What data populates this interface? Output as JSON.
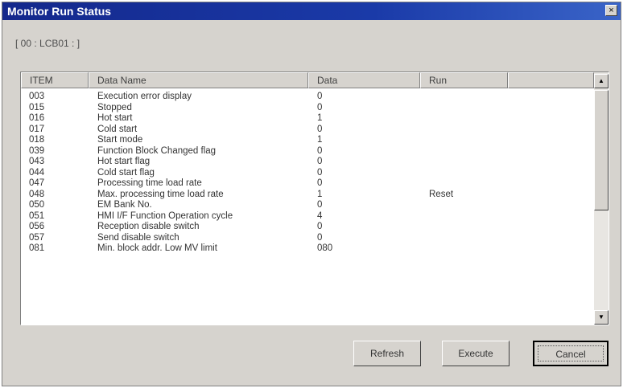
{
  "window": {
    "title": "Monitor Run Status",
    "close_glyph": "×"
  },
  "address": "[ 00 : LCB01 : ]",
  "table": {
    "columns": [
      "ITEM",
      "Data Name",
      "Data",
      "Run",
      ""
    ],
    "rows": [
      {
        "item": "003",
        "name": "Execution error display",
        "data": "0",
        "run": ""
      },
      {
        "item": "015",
        "name": "Stopped",
        "data": "0",
        "run": ""
      },
      {
        "item": "016",
        "name": "Hot start",
        "data": "1",
        "run": ""
      },
      {
        "item": "017",
        "name": "Cold start",
        "data": "0",
        "run": ""
      },
      {
        "item": "018",
        "name": "Start mode",
        "data": "1",
        "run": ""
      },
      {
        "item": "039",
        "name": "Function Block Changed flag",
        "data": "0",
        "run": ""
      },
      {
        "item": "043",
        "name": "Hot start flag",
        "data": "0",
        "run": ""
      },
      {
        "item": "044",
        "name": "Cold start flag",
        "data": "0",
        "run": ""
      },
      {
        "item": "047",
        "name": "Processing time load rate",
        "data": "0",
        "run": ""
      },
      {
        "item": "048",
        "name": "Max. processing time load rate",
        "data": "1",
        "run": "Reset"
      },
      {
        "item": "050",
        "name": "EM Bank No.",
        "data": "0",
        "run": ""
      },
      {
        "item": "051",
        "name": "HMI I/F Function Operation cycle",
        "data": "4",
        "run": ""
      },
      {
        "item": "056",
        "name": "Reception disable switch",
        "data": "0",
        "run": ""
      },
      {
        "item": "057",
        "name": "Send disable switch",
        "data": "0",
        "run": ""
      },
      {
        "item": "081",
        "name": "Min. block addr. Low MV limit",
        "data": "080",
        "run": ""
      }
    ]
  },
  "buttons": {
    "refresh": "Refresh",
    "execute": "Execute",
    "cancel": "Cancel"
  },
  "icons": {
    "scroll_up": "up-arrow-icon",
    "scroll_down": "down-arrow-icon",
    "close": "close-icon"
  }
}
